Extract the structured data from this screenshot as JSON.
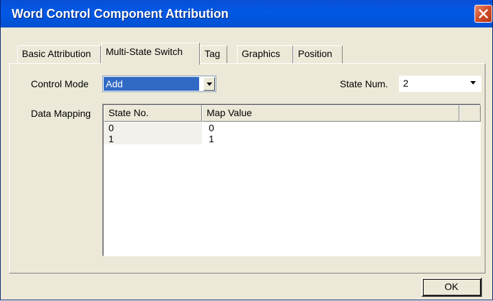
{
  "window": {
    "title": "Word Control Component Attribution",
    "title_bar_color": "#0058e6"
  },
  "tabs": [
    {
      "label": "Basic Attribution",
      "active": false
    },
    {
      "label": "Multi-State Switch",
      "active": true
    },
    {
      "label": "Tag",
      "active": false
    },
    {
      "label": "Graphics",
      "active": false
    },
    {
      "label": "Position",
      "active": false
    }
  ],
  "control_mode": {
    "label": "Control Mode",
    "value": "Add",
    "selection_color": "#316ac5"
  },
  "state_num": {
    "label": "State Num.",
    "value": "2"
  },
  "data_mapping": {
    "label": "Data Mapping",
    "columns": [
      "State No.",
      "Map Value"
    ],
    "rows": [
      [
        "0",
        "0"
      ],
      [
        "1",
        "1"
      ]
    ]
  },
  "buttons": {
    "ok_label": "OK"
  },
  "icons": {
    "close": "close-icon",
    "dropdown": "chevron-down-icon"
  }
}
